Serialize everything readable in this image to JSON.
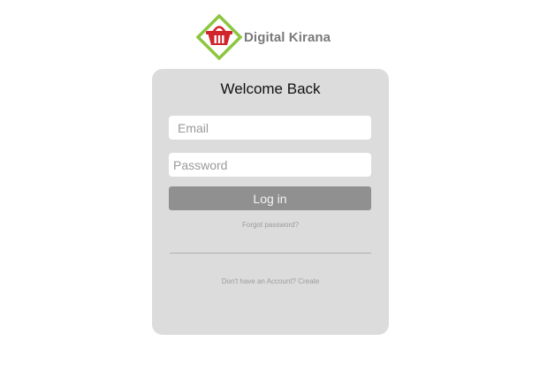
{
  "brand": {
    "logo_icon": "basket-diamond-logo",
    "name": "Digital Kirana",
    "colors": {
      "diamond": "#8cc63f",
      "basket": "#d0252b"
    }
  },
  "login": {
    "title": "Welcome Back",
    "email_placeholder": "Email",
    "password_placeholder": "Password",
    "login_label": "Log in",
    "forgot_label": "Forgot password?",
    "signup_prompt": "Don't have an Account?",
    "create_label": "Create"
  },
  "colors": {
    "card_background": "#dcdcdc",
    "button_background": "#909090"
  }
}
